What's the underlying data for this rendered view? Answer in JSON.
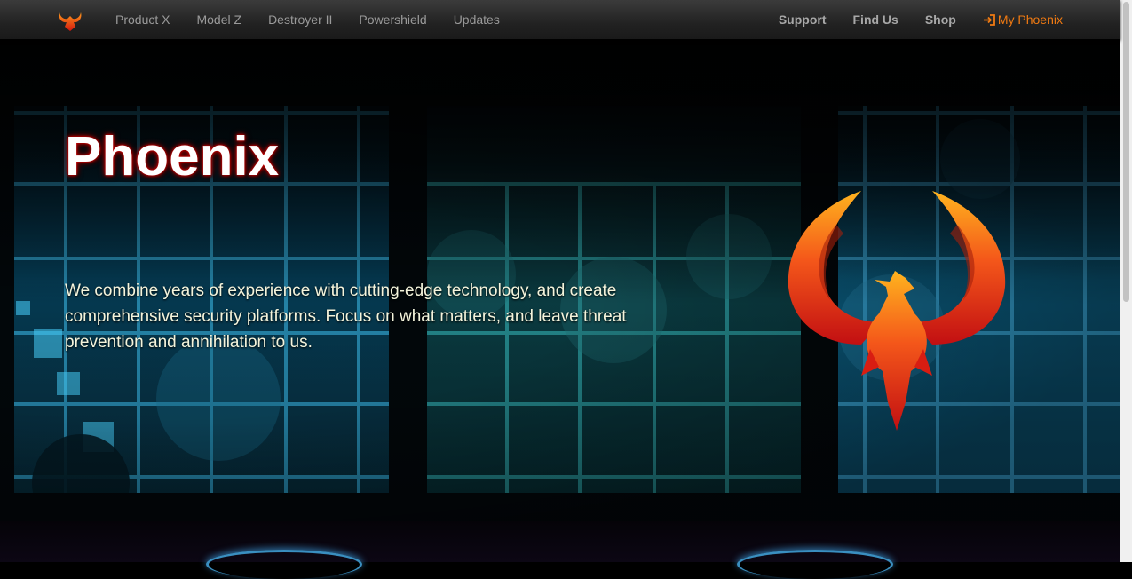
{
  "nav": {
    "brand_icon": "phoenix-logo-icon",
    "left_links": [
      "Product X",
      "Model Z",
      "Destroyer II",
      "Powershield",
      "Updates"
    ],
    "right_links": [
      "Support",
      "Find Us",
      "Shop"
    ],
    "account_link": "My Phoenix",
    "account_icon": "sign-in-icon",
    "account_color": "#f07a12"
  },
  "hero": {
    "title": "Phoenix",
    "text": "We combine years of experience with cutting-edge technology, and create comprehensive security platforms. Focus on what matters, and leave threat prevention and annihilation to us.",
    "image_icon": "phoenix-emblem-icon"
  }
}
